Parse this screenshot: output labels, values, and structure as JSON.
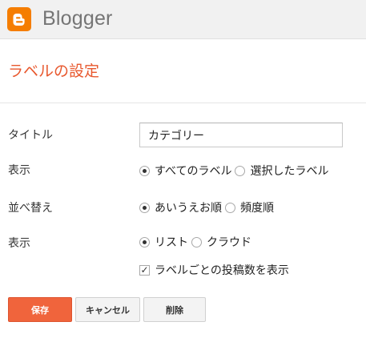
{
  "app": {
    "brand": "Blogger",
    "logo_icon": "blogger-logo-icon",
    "brand_color": "#f57d00"
  },
  "page": {
    "title": "ラベルの設定",
    "title_color": "#e8582e"
  },
  "form": {
    "title_field": {
      "label": "タイトル",
      "value": "カテゴリー"
    },
    "display": {
      "label": "表示",
      "options": [
        {
          "label": "すべてのラベル",
          "checked": true
        },
        {
          "label": "選択したラベル",
          "checked": false
        }
      ]
    },
    "sort": {
      "label": "並べ替え",
      "options": [
        {
          "label": "あいうえお順",
          "checked": true
        },
        {
          "label": "頻度順",
          "checked": false
        }
      ]
    },
    "style": {
      "label": "表示",
      "options": [
        {
          "label": "リスト",
          "checked": true
        },
        {
          "label": "クラウド",
          "checked": false
        }
      ]
    },
    "show_counts": {
      "label": "ラベルごとの投稿数を表示",
      "checked": true
    }
  },
  "buttons": {
    "save": "保存",
    "cancel": "キャンセル",
    "delete": "削除",
    "save_color": "#f0643c"
  }
}
